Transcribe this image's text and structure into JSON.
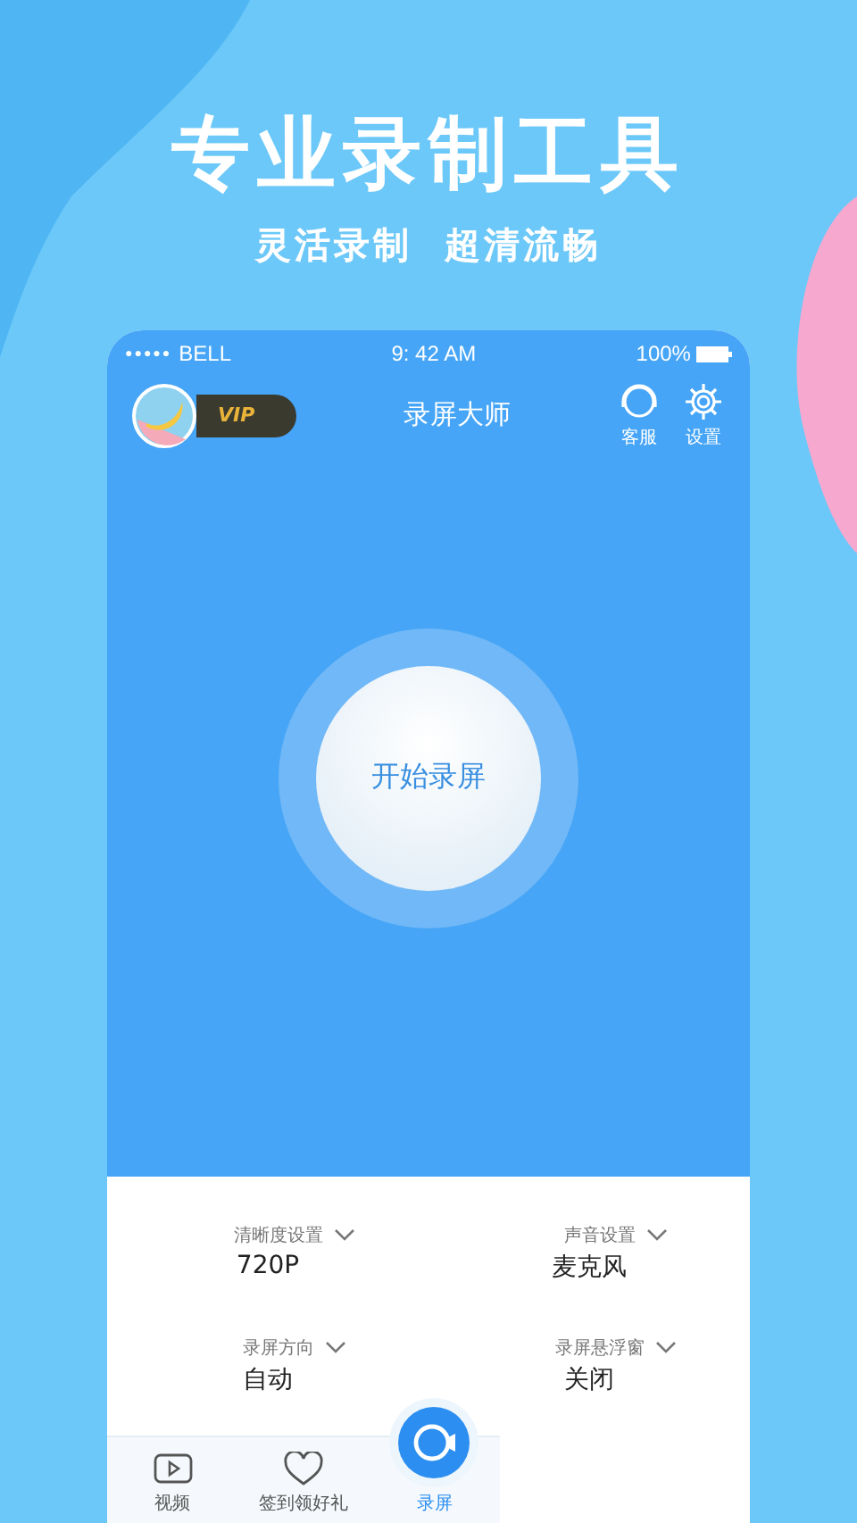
{
  "headline": "专业录制工具",
  "subheadline": "灵活录制  超清流畅",
  "status_bar": {
    "signal": "●●●●●",
    "carrier": "BELL",
    "time": "9: 42 AM",
    "battery": "100%"
  },
  "header": {
    "badge": "VIP",
    "title": "录屏大师",
    "actions": [
      {
        "label": "客服",
        "kind": "support"
      },
      {
        "label": "设置",
        "kind": "settings"
      }
    ]
  },
  "record_button": {
    "label": "开始录屏"
  },
  "settings": [
    {
      "label": "清晰度设置",
      "value": "720P"
    },
    {
      "label": "声音设置",
      "value": "麦克风"
    },
    {
      "label": "录屏方向",
      "value": "自动"
    },
    {
      "label": "录屏悬浮窗",
      "value": "关闭"
    }
  ],
  "tab_bar": [
    {
      "label": "视频",
      "kind": "video",
      "selected": false
    },
    {
      "label": "签到领好礼",
      "kind": "heart",
      "selected": false
    },
    {
      "label": "录屏",
      "kind": "record",
      "selected": true
    }
  ]
}
